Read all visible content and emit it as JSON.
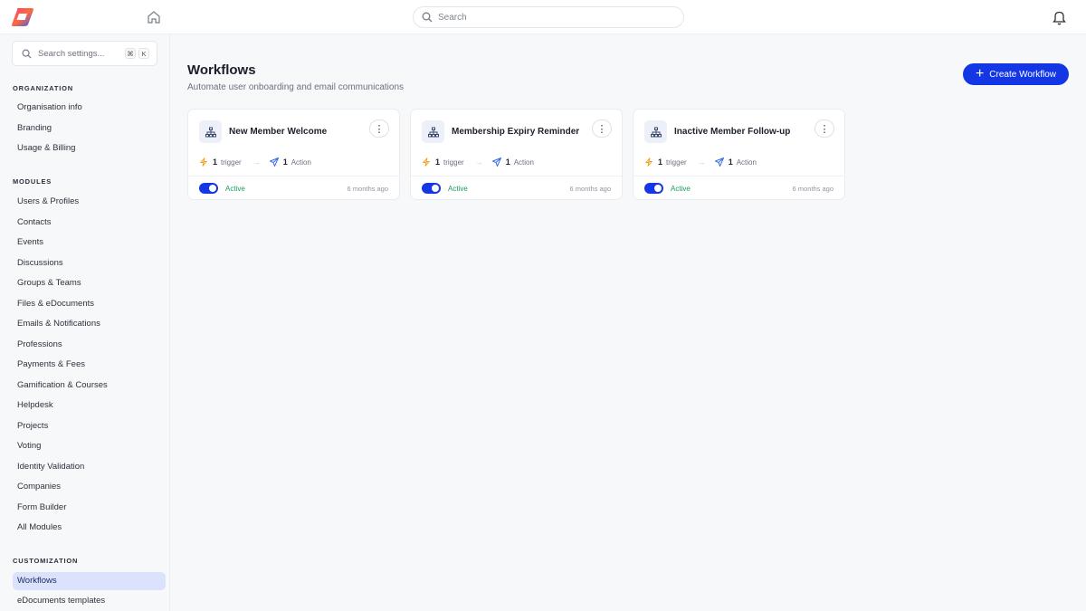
{
  "topbar": {
    "search_placeholder": "Search"
  },
  "sidebar": {
    "search_placeholder": "Search settings...",
    "shortcut_keys": [
      "⌘",
      "K"
    ],
    "sections": {
      "organization": {
        "title": "ORGANIZATION",
        "items": [
          "Organisation info",
          "Branding",
          "Usage & Billing"
        ]
      },
      "modules": {
        "title": "MODULES",
        "items": [
          "Users & Profiles",
          "Contacts",
          "Events",
          "Discussions",
          "Groups & Teams",
          "Files & eDocuments",
          "Emails & Notifications",
          "Professions",
          "Payments & Fees",
          "Gamification & Courses",
          "Helpdesk",
          "Projects",
          "Voting",
          "Identity Validation",
          "Companies",
          "Form Builder",
          "All Modules"
        ]
      },
      "customization": {
        "title": "CUSTOMIZATION",
        "items": [
          "Workflows",
          "eDocuments templates"
        ],
        "active": "Workflows"
      }
    }
  },
  "main": {
    "title": "Workflows",
    "subtitle": "Automate user onboarding and email communications",
    "create_button": "Create Workflow",
    "workflows": [
      {
        "name": "New Member Welcome",
        "triggers": "1",
        "trigger_label": "trigger",
        "actions": "1",
        "action_label": "Action",
        "status": "Active",
        "enabled": true,
        "updated": "6 months ago"
      },
      {
        "name": "Membership Expiry Reminder",
        "triggers": "1",
        "trigger_label": "trigger",
        "actions": "1",
        "action_label": "Action",
        "status": "Active",
        "enabled": true,
        "updated": "6 months ago"
      },
      {
        "name": "Inactive Member Follow-up",
        "triggers": "1",
        "trigger_label": "trigger",
        "actions": "1",
        "action_label": "Action",
        "status": "Active",
        "enabled": true,
        "updated": "6 months ago"
      }
    ]
  },
  "colors": {
    "accent": "#1437e6",
    "active_nav_bg": "#dbe2fb",
    "status_active": "#18a058",
    "trigger_icon": "#f0a020",
    "action_icon": "#3b6fe0"
  },
  "icons": {
    "logo": "app-logo",
    "home": "home-icon",
    "search": "search-icon",
    "bell": "bell-icon",
    "workflow": "sitemap-icon",
    "trigger": "lightning-icon",
    "action": "send-icon",
    "menu": "more-vertical-icon"
  }
}
